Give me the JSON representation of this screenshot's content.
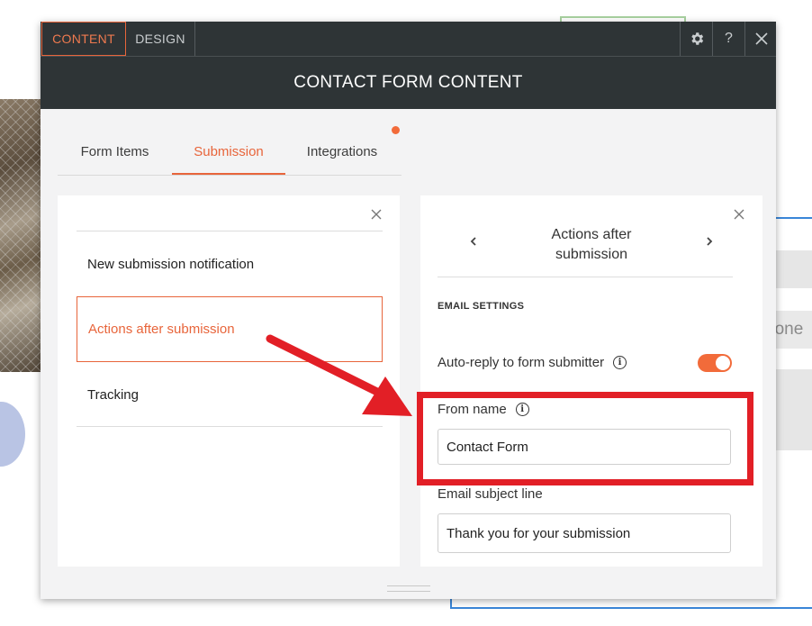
{
  "background": {
    "partial_text": "hone"
  },
  "topbar": {
    "tab_content": "CONTENT",
    "tab_design": "DESIGN",
    "settings_icon": "gear-icon",
    "help_label": "?",
    "close_icon": "close-icon"
  },
  "title": "CONTACT FORM CONTENT",
  "subtabs": [
    {
      "label": "Form Items"
    },
    {
      "label": "Submission",
      "active": true
    },
    {
      "label": "Integrations"
    }
  ],
  "left_card": {
    "items": [
      {
        "label": "New submission notification"
      },
      {
        "label": "Actions after submission",
        "selected": true
      },
      {
        "label": "Tracking"
      }
    ]
  },
  "right_card": {
    "title_line1": "Actions after",
    "title_line2": "submission",
    "section_label": "EMAIL SETTINGS",
    "auto_reply_label": "Auto-reply to form submitter",
    "auto_reply_enabled": true,
    "from_name_label": "From name",
    "from_name_value": "Contact Form",
    "subject_label": "Email subject line",
    "subject_value": "Thank you for your submission"
  },
  "colors": {
    "accent": "#e8653b",
    "dark_header": "#2e3436",
    "annotation_red": "#e21f26"
  }
}
